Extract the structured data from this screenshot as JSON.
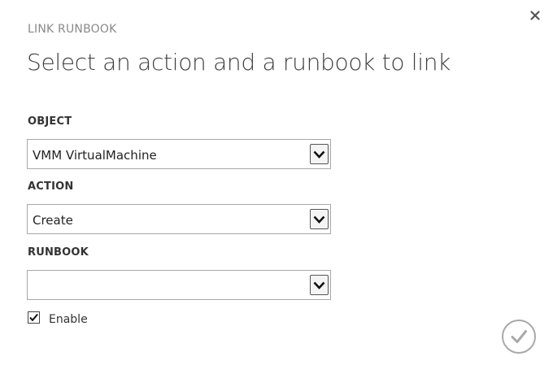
{
  "dialog": {
    "eyebrow": "LINK RUNBOOK",
    "heading": "Select an action and a runbook to link"
  },
  "fields": {
    "object": {
      "label": "OBJECT",
      "value": "VMM VirtualMachine"
    },
    "action": {
      "label": "ACTION",
      "value": "Create"
    },
    "runbook": {
      "label": "RUNBOOK",
      "value": ""
    }
  },
  "enable": {
    "label": "Enable",
    "checked": true
  },
  "icons": {
    "close": "close-icon",
    "confirm": "checkmark-icon",
    "dropdown": "chevron-down-icon"
  },
  "colors": {
    "heading": "#404040",
    "eyebrow": "#8a8a8a",
    "border": "#a8a8a8"
  }
}
